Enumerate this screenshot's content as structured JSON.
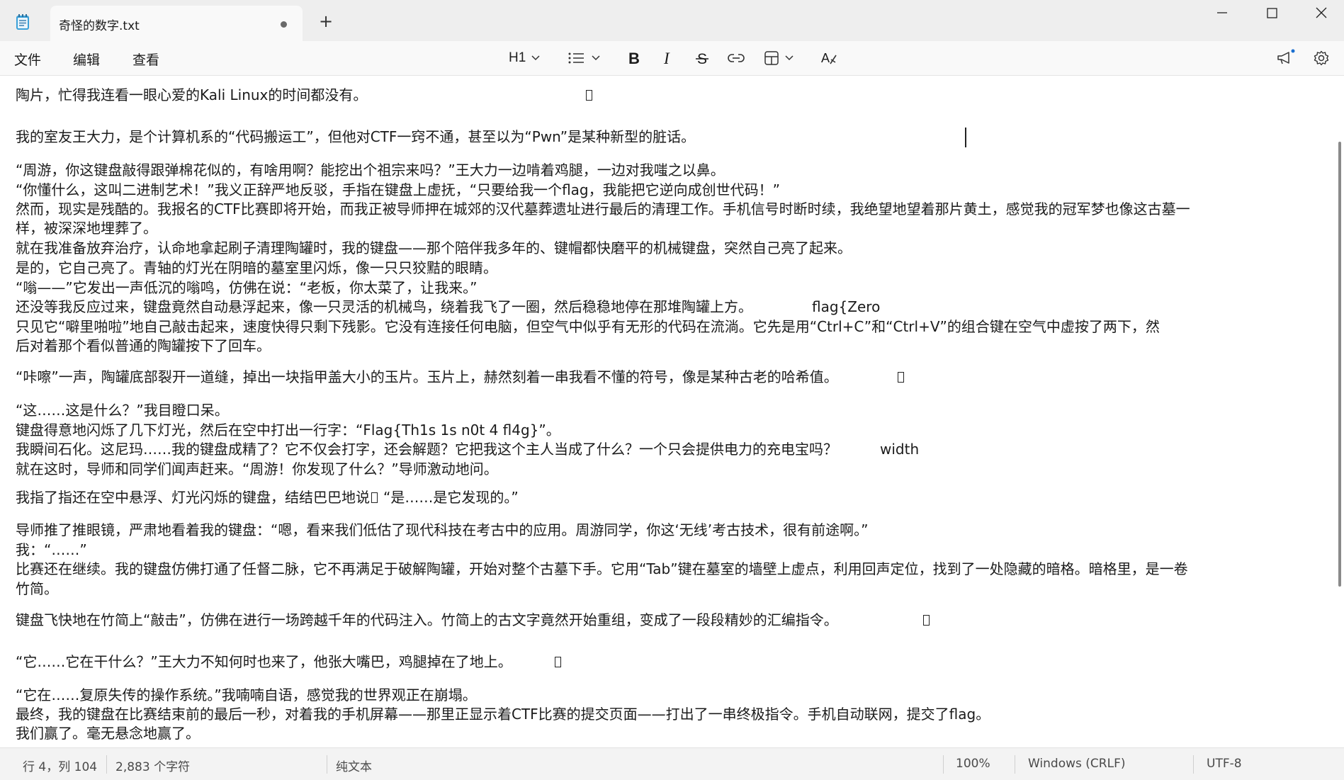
{
  "window": {
    "tab_title": "奇怪的数字.txt"
  },
  "menu": {
    "file": "文件",
    "edit": "编辑",
    "view": "查看"
  },
  "toolbar": {
    "heading": "H1"
  },
  "editor": {
    "lines": [
      "陶片，忙得我连看一眼心爱的Kali Linux的时间都没有。",
      "我的室友王大力，是个计算机系的“代码搬运工”，但他对CTF一窍不通，甚至以为“Pwn”是某种新型的脏话。",
      "“周游，你这键盘敲得跟弹棉花似的，有啥用啊？能挖出个祖宗来吗？”王大力一边啃着鸡腿，一边对我嗤之以鼻。",
      "“你懂什么，这叫二进制艺术！”我义正辞严地反驳，手指在键盘上虚抚，“只要给我一个flag，我能把它逆向成创世代码！”",
      "然而，现实是残酷的。我报名的CTF比赛即将开始，而我正被导师押在城郊的汉代墓葬遗址进行最后的清理工作。手机信号时断时续，我绝望地望着那片黄土，感觉我的冠军梦也像这古墓一",
      "样，被深深地埋葬了。",
      "就在我准备放弃治疗，认命地拿起刷子清理陶罐时，我的键盘——那个陪伴我多年的、键帽都快磨平的机械键盘，突然自己亮了起来。",
      "是的，它自己亮了。青轴的灯光在阴暗的墓室里闪烁，像一只只狡黠的眼睛。",
      "“嗡——”它发出一声低沉的嗡鸣，仿佛在说：“老板，你太菜了，让我来。”",
      "还没等我反应过来，键盘竟然自动悬浮起来，像一只灵活的机械鸟，绕着我飞了一圈，然后稳稳地停在那堆陶罐上方。",
      "flag{Zero",
      "只见它“噼里啪啦”地自己敲击起来，速度快得只剩下残影。它没有连接任何电脑，但空气中似乎有无形的代码在流淌。它先是用“Ctrl+C”和“Ctrl+V”的组合键在空气中虚按了两下，然",
      "后对着那个看似普通的陶罐按下了回车。",
      "“咔嚓”一声，陶罐底部裂开一道缝，掉出一块指甲盖大小的玉片。玉片上，赫然刻着一串我看不懂的符号，像是某种古老的哈希值。",
      "“这……这是什么？”我目瞪口呆。",
      "键盘得意地闪烁了几下灯光，然后在空中打出一行字：“Flag{Th1s 1s n0t 4 fl4g}”。",
      "我瞬间石化。这尼玛……我的键盘成精了？它不仅会打字，还会解题？它把我这个主人当成了什么？一个只会提供电力的充电宝吗？",
      "width",
      "就在这时，导师和同学们闻声赶来。“周游！你发现了什么？”导师激动地问。",
      "我指了指还在空中悬浮、灯光闪烁的键盘，结结巴巴地说",
      "“是……是它发现的。”",
      "导师推了推眼镜，严肃地看着我的键盘：“嗯，看来我们低估了现代科技在考古中的应用。周游同学，你这‘无线’考古技术，很有前途啊。”",
      "我：“……”",
      "比赛还在继续。我的键盘仿佛打通了任督二脉，它不再满足于破解陶罐，开始对整个古墓下手。它用“Tab”键在墓室的墙壁上虚点，利用回声定位，找到了一处隐藏的暗格。暗格里，是一卷",
      "竹简。",
      "键盘飞快地在竹简上“敲击”，仿佛在进行一场跨越千年的代码注入。竹简上的古文字竟然开始重组，变成了一段段精妙的汇编指令。",
      "“它……它在干什么？”王大力不知何时也来了，他张大嘴巴，鸡腿掉在了地上。",
      "“它在……复原失传的操作系统。”我喃喃自语，感觉我的世界观正在崩塌。",
      "最终，我的键盘在比赛结束前的最后一秒，对着我的手机屏幕——那里正显示着CTF比赛的提交页面——打出了一串终极指令。手机自动联网，提交了flag。",
      "我们赢了。毫无悬念地赢了。"
    ]
  },
  "status": {
    "position": "行 4，列 104",
    "char_count": "2,883 个字符",
    "format": "纯文本",
    "zoom": "100%",
    "line_ending": "Windows (CRLF)",
    "encoding": "UTF-8"
  }
}
